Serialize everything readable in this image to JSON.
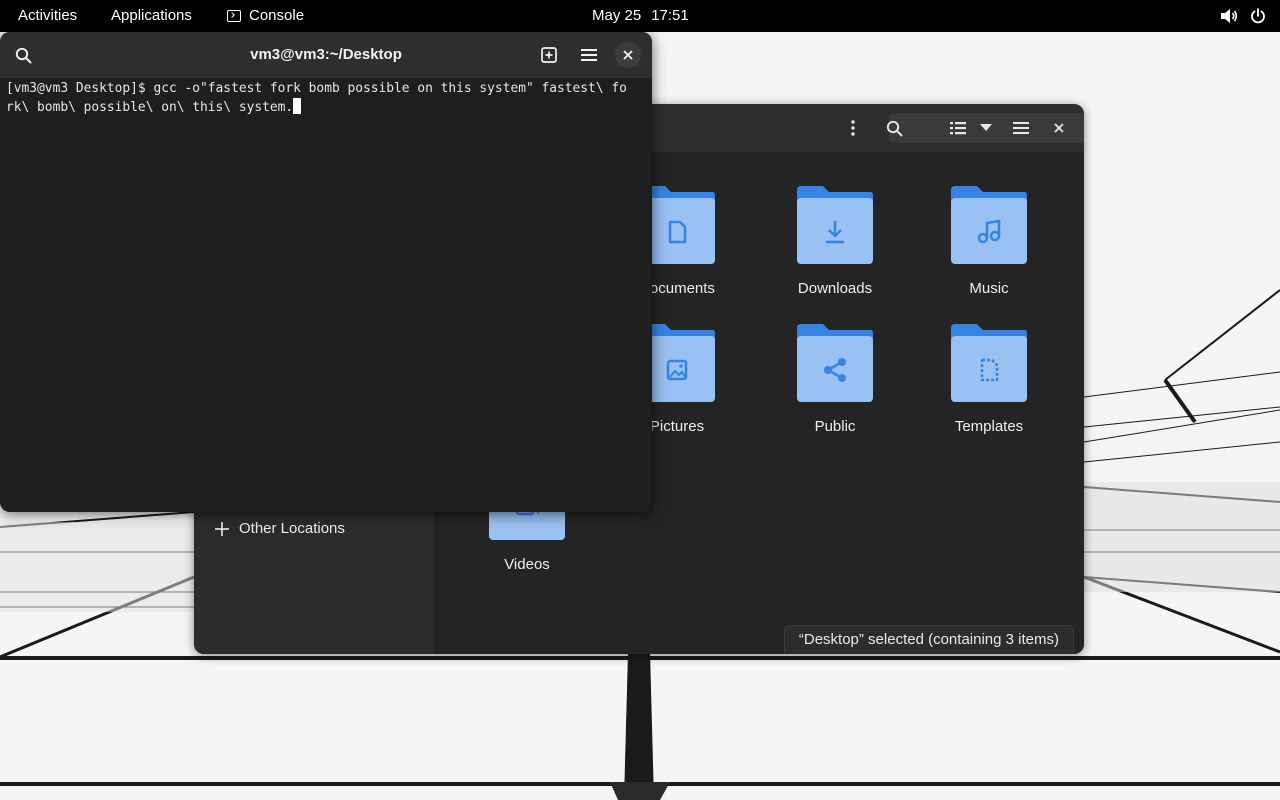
{
  "topbar": {
    "activities": "Activities",
    "applications": "Applications",
    "app_name": "Console",
    "date": "May 25",
    "time": "17:51",
    "icons": [
      "volume-icon",
      "power-icon"
    ]
  },
  "terminal": {
    "title": "vm3@vm3:~/Desktop",
    "lines": [
      "[vm3@vm3 Desktop]$ gcc -o\"fastest fork bomb possible on this system\" fastest\\ fo",
      "rk\\ bomb\\ possible\\ on\\ this\\ system."
    ],
    "header_icons": [
      "search-icon",
      "new-tab-icon",
      "menu-icon",
      "close-icon"
    ]
  },
  "files": {
    "folders": [
      {
        "name": "Documents",
        "icon": "document-icon"
      },
      {
        "name": "Downloads",
        "icon": "download-icon"
      },
      {
        "name": "Music",
        "icon": "music-icon"
      },
      {
        "name": "Pictures",
        "icon": "image-icon"
      },
      {
        "name": "Public",
        "icon": "share-icon"
      },
      {
        "name": "Templates",
        "icon": "template-icon"
      },
      {
        "name": "Videos",
        "icon": "video-icon"
      }
    ],
    "sidebar_other_locations": "Other Locations",
    "status": "“Desktop” selected  (containing 3 items)",
    "header_icons": [
      "more-options-icon",
      "search-icon",
      "list-view-icon",
      "view-options-dropdown-icon",
      "menu-icon",
      "close-icon"
    ]
  },
  "colors": {
    "folder_back": "#3584e4",
    "folder_front": "#99c1f1",
    "folder_glyph": "#3584e4",
    "terminal_bg": "#1e1e1e",
    "header_bg": "#2e2e2e",
    "topbar_bg": "#000000"
  }
}
